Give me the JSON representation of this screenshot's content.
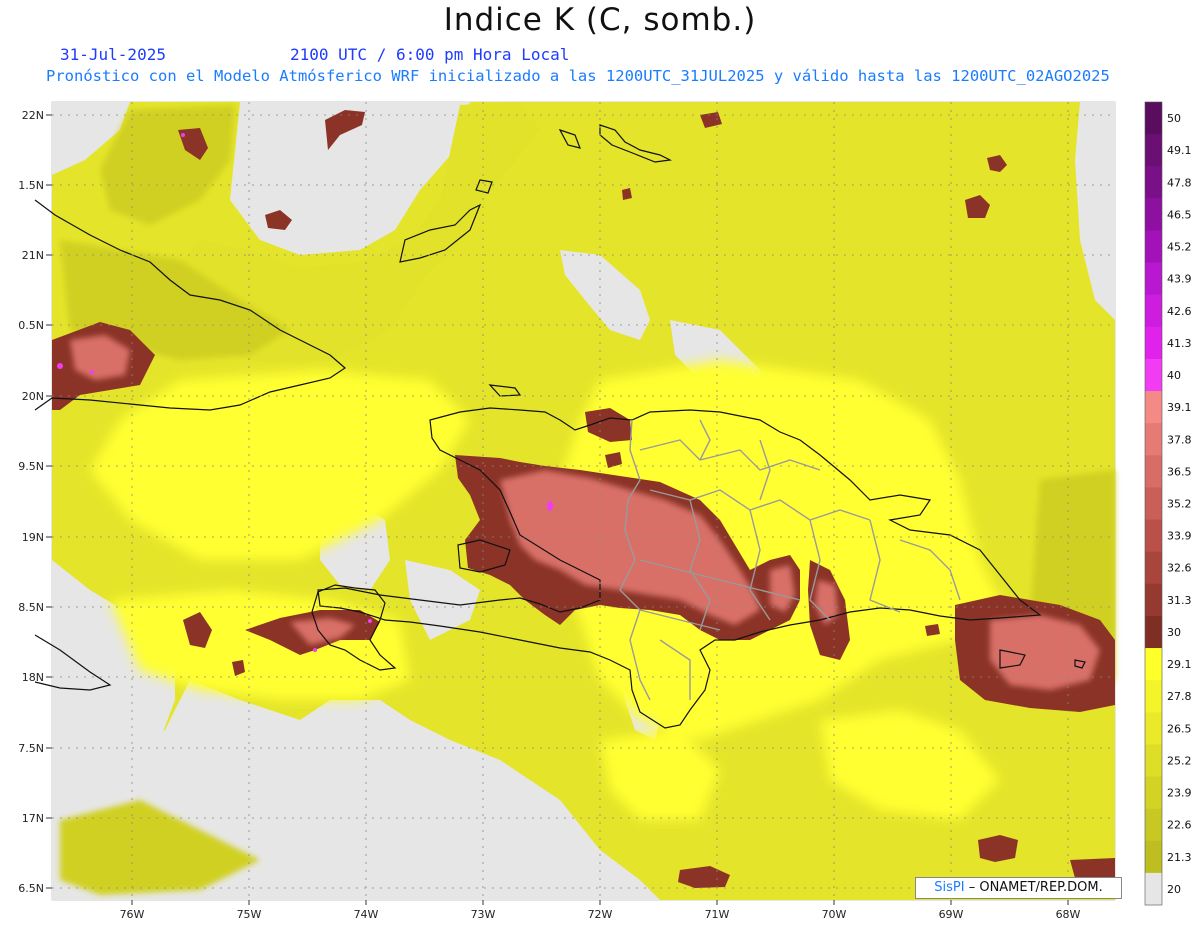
{
  "header": {
    "title": "Indice K (C, somb.)",
    "date": "31-Jul-2025",
    "valid_time": "2100 UTC / 6:00 pm Hora Local",
    "description": "Pronóstico con el Modelo Atmósferico WRF inicializado a las 1200UTC_31JUL2025 y válido hasta las  1200UTC_02AGO2025"
  },
  "axes": {
    "lat_labels": [
      "22N",
      "1.5N",
      "21N",
      "0.5N",
      "20N",
      "9.5N",
      "19N",
      "8.5N",
      "18N",
      "7.5N",
      "17N",
      "6.5N"
    ],
    "lon_labels": [
      "76W",
      "75W",
      "74W",
      "73W",
      "72W",
      "71W",
      "70W",
      "69W",
      "68W"
    ]
  },
  "colorbar": {
    "labels": [
      "50",
      "49.1",
      "47.8",
      "46.5",
      "45.2",
      "43.9",
      "42.6",
      "41.3",
      "40",
      "39.1",
      "37.8",
      "36.5",
      "35.2",
      "33.9",
      "32.6",
      "31.3",
      "30",
      "29.1",
      "27.8",
      "26.5",
      "25.2",
      "23.9",
      "22.6",
      "21.3",
      "20"
    ],
    "colors": [
      "#5a0d5e",
      "#6b0f75",
      "#7a1088",
      "#8d10a0",
      "#a212b8",
      "#b818cf",
      "#cd1ee0",
      "#e022ec",
      "#f23cf4",
      "#f48a86",
      "#e67a74",
      "#d86c66",
      "#c95f58",
      "#b9514a",
      "#a8453d",
      "#963a31",
      "#7f2e24",
      "#ffff2a",
      "#f4f42a",
      "#eaea2a",
      "#dede28",
      "#d3d326",
      "#c8c824",
      "#bebe20",
      "#e6e6e6"
    ]
  },
  "credit": {
    "brand": "SisPI",
    "text": "– ONAMET/REP.DOM."
  },
  "colors": {
    "land_low": "#d2d224",
    "moderate": "#eeee2a",
    "high": "#ffff30",
    "unstable": "#8a3326",
    "very_unstable": "#d86c66",
    "extreme": "#f23cf4",
    "missing": "#e6e6e6"
  }
}
